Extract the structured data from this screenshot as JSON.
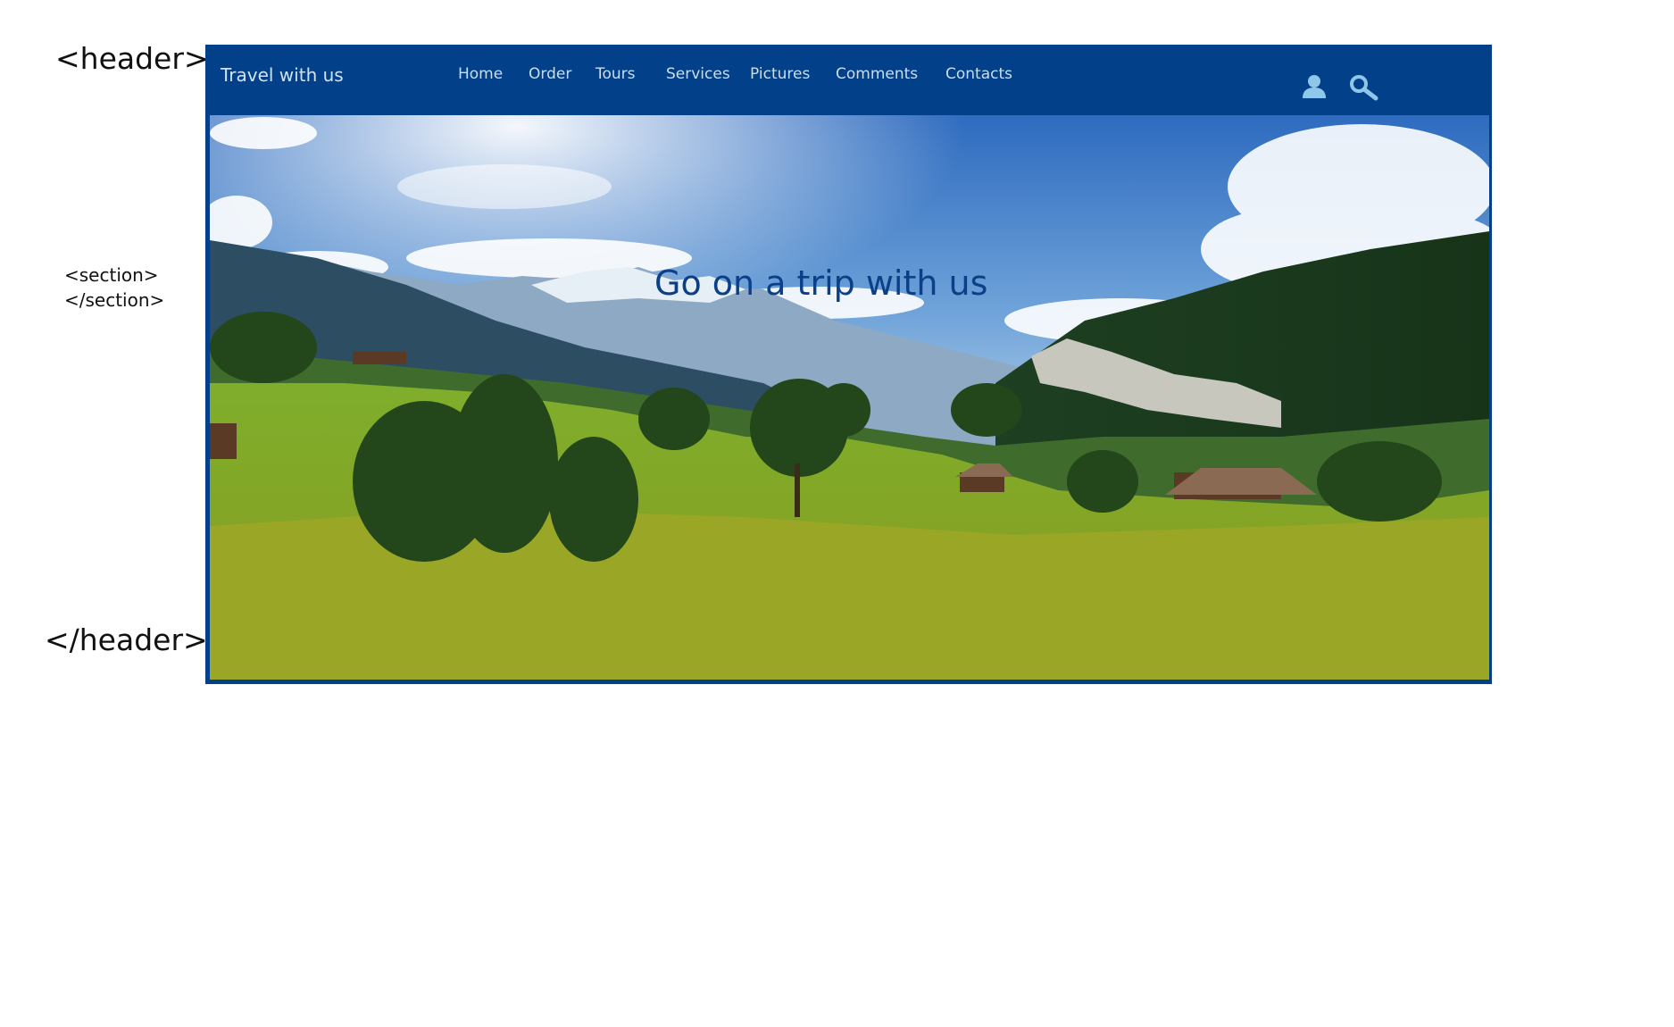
{
  "annotations": {
    "header_open": "<header>",
    "section_open": "<section>",
    "section_close": "</section>",
    "header_close": "</header>"
  },
  "header": {
    "brand": "Travel with us",
    "nav": [
      {
        "label": "Home"
      },
      {
        "label": "Order"
      },
      {
        "label": "Tours"
      },
      {
        "label": "Services"
      },
      {
        "label": "Pictures"
      },
      {
        "label": "Comments"
      },
      {
        "label": "Contacts"
      }
    ],
    "icons": {
      "user": "user-icon",
      "search": "search-icon"
    }
  },
  "hero": {
    "title": "Go on a trip with us"
  },
  "colors": {
    "header_bg": "#03408a",
    "nav_text": "#c9def2",
    "hero_title": "#0b3f87",
    "icon": "#8ec7ea"
  }
}
